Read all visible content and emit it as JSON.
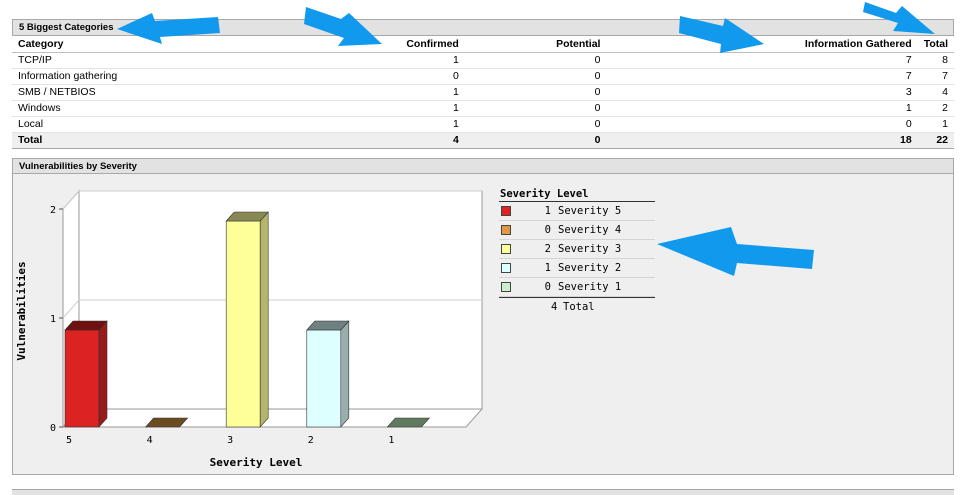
{
  "categories_panel": {
    "title": "5 Biggest Categories",
    "columns": [
      "Category",
      "Confirmed",
      "Potential",
      "Information Gathered",
      "Total"
    ],
    "rows": [
      {
        "category": "TCP/IP",
        "confirmed": "1",
        "potential": "0",
        "info": "7",
        "total": "8"
      },
      {
        "category": "Information gathering",
        "confirmed": "0",
        "potential": "0",
        "info": "7",
        "total": "7"
      },
      {
        "category": "SMB / NETBIOS",
        "confirmed": "1",
        "potential": "0",
        "info": "3",
        "total": "4"
      },
      {
        "category": "Windows",
        "confirmed": "1",
        "potential": "0",
        "info": "1",
        "total": "2"
      },
      {
        "category": "Local",
        "confirmed": "1",
        "potential": "0",
        "info": "0",
        "total": "1"
      }
    ],
    "total_row": {
      "label": "Total",
      "confirmed": "4",
      "potential": "0",
      "info": "18",
      "total": "22"
    }
  },
  "severity_panel": {
    "title": "Vulnerabilities by Severity",
    "legend": {
      "title": "Severity Level",
      "items": [
        {
          "count": "1",
          "label": "Severity 5",
          "color": "#dd2222"
        },
        {
          "count": "0",
          "label": "Severity 4",
          "color": "#dd9944"
        },
        {
          "count": "2",
          "label": "Severity 3",
          "color": "#ffff99"
        },
        {
          "count": "1",
          "label": "Severity 2",
          "color": "#ddffff"
        },
        {
          "count": "0",
          "label": "Severity 1",
          "color": "#cceecc"
        }
      ],
      "total_count": "4",
      "total_label": "Total"
    }
  },
  "chart_data": {
    "type": "bar",
    "title": "",
    "xlabel": "Severity Level",
    "ylabel": "Vulnerabilities",
    "categories": [
      "5",
      "4",
      "3",
      "2",
      "1"
    ],
    "values": [
      1,
      0,
      2,
      1,
      0
    ],
    "ylim": [
      0,
      2
    ],
    "yticks": [
      "0",
      "1",
      "2"
    ],
    "colors": [
      "#dd2222",
      "#7a5a2a",
      "#ffff99",
      "#ddffff",
      "#6f8a6f"
    ],
    "top_colors": [
      "#6e1111",
      "#6b4b1f",
      "#888855",
      "#6e8080",
      "#5f7a5f"
    ],
    "side_colors": [
      "#991a1a",
      "#5a3f18",
      "#b5b56c",
      "#9aaeae",
      "#5a6f5a"
    ],
    "grid": true,
    "style": "3d"
  },
  "annotations": {
    "arrow_color": "#1199ee",
    "arrow_targets": [
      "5 Biggest Categories",
      "Confirmed",
      "Information Gathered",
      "Total",
      "Severity Level"
    ]
  }
}
